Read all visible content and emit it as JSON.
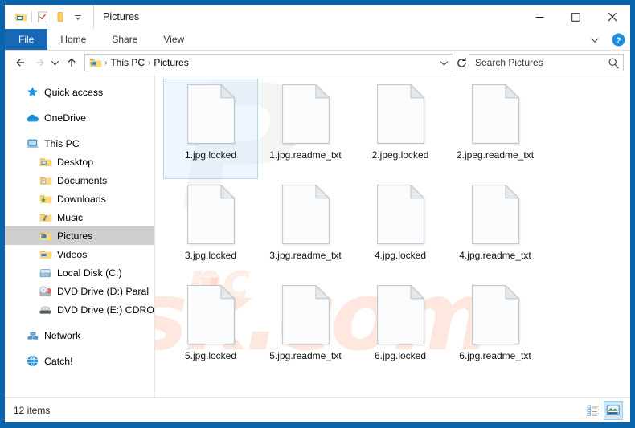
{
  "window": {
    "title": "Pictures",
    "accent_blue": "#0a64ad",
    "file_tab_blue": "#1869b5"
  },
  "quick_access_toolbar": [
    {
      "icon": "explorer-icon",
      "name": "explorer-properties"
    },
    {
      "icon": "properties-checkmark-icon",
      "name": "properties"
    },
    {
      "icon": "new-folder-icon",
      "name": "new-folder"
    },
    {
      "icon": "chevron-down-icon",
      "name": "customize-qat"
    }
  ],
  "window_controls": {
    "minimize": "—",
    "maximize": "☐",
    "close": "✕"
  },
  "ribbon": {
    "file_tab": "File",
    "tabs": [
      "Home",
      "Share",
      "View"
    ],
    "collapse_icon": "chevron-down-icon",
    "help_icon": "help-circle-icon"
  },
  "addressbar": {
    "back_icon": "arrow-left-icon",
    "forward_icon": "arrow-right-icon",
    "recent_icon": "chevron-down-icon",
    "up_icon": "arrow-up-icon",
    "folder_icon": "pictures-folder-icon",
    "crumbs": [
      "This PC",
      "Pictures"
    ],
    "separator": "›",
    "dropdown_icon": "chevron-down-icon",
    "refresh_icon": "refresh-icon"
  },
  "search": {
    "placeholder": "Search Pictures",
    "value": "",
    "icon": "search-icon"
  },
  "sidebar": {
    "items": [
      {
        "label": "Quick access",
        "icon": "star-icon",
        "level": 0,
        "selected": false,
        "gap_after": true
      },
      {
        "label": "OneDrive",
        "icon": "cloud-icon",
        "level": 0,
        "selected": false,
        "gap_after": true
      },
      {
        "label": "This PC",
        "icon": "computer-icon",
        "level": 0,
        "selected": false,
        "gap_after": false
      },
      {
        "label": "Desktop",
        "icon": "desktop-folder-icon",
        "level": 1,
        "selected": false,
        "gap_after": false
      },
      {
        "label": "Documents",
        "icon": "documents-folder-icon",
        "level": 1,
        "selected": false,
        "gap_after": false
      },
      {
        "label": "Downloads",
        "icon": "downloads-folder-icon",
        "level": 1,
        "selected": false,
        "gap_after": false
      },
      {
        "label": "Music",
        "icon": "music-folder-icon",
        "level": 1,
        "selected": false,
        "gap_after": false
      },
      {
        "label": "Pictures",
        "icon": "pictures-folder-icon",
        "level": 1,
        "selected": true,
        "gap_after": false
      },
      {
        "label": "Videos",
        "icon": "videos-folder-icon",
        "level": 1,
        "selected": false,
        "gap_after": false
      },
      {
        "label": "Local Disk (C:)",
        "icon": "hard-drive-icon",
        "level": 1,
        "selected": false,
        "gap_after": false
      },
      {
        "label": "DVD Drive (D:) Paral",
        "icon": "dvd-drive-icon",
        "level": 1,
        "selected": false,
        "gap_after": false
      },
      {
        "label": "DVD Drive (E:) CDRO",
        "icon": "cd-drive-icon",
        "level": 1,
        "selected": false,
        "gap_after": true
      },
      {
        "label": "Network",
        "icon": "network-icon",
        "level": 0,
        "selected": false,
        "gap_after": true
      },
      {
        "label": "Catch!",
        "icon": "catch-globe-icon",
        "level": 0,
        "selected": false,
        "gap_after": false
      }
    ]
  },
  "files": [
    {
      "name": "1.jpg.locked",
      "icon": "blank-document-icon",
      "selected": true
    },
    {
      "name": "1.jpg.readme_txt",
      "icon": "blank-document-icon",
      "selected": false
    },
    {
      "name": "2.jpeg.locked",
      "icon": "blank-document-icon",
      "selected": false
    },
    {
      "name": "2.jpeg.readme_txt",
      "icon": "blank-document-icon",
      "selected": false
    },
    {
      "name": "3.jpg.locked",
      "icon": "blank-document-icon",
      "selected": false
    },
    {
      "name": "3.jpg.readme_txt",
      "icon": "blank-document-icon",
      "selected": false
    },
    {
      "name": "4.jpg.locked",
      "icon": "blank-document-icon",
      "selected": false
    },
    {
      "name": "4.jpg.readme_txt",
      "icon": "blank-document-icon",
      "selected": false
    },
    {
      "name": "5.jpg.locked",
      "icon": "blank-document-icon",
      "selected": false
    },
    {
      "name": "5.jpg.readme_txt",
      "icon": "blank-document-icon",
      "selected": false
    },
    {
      "name": "6.jpg.locked",
      "icon": "blank-document-icon",
      "selected": false
    },
    {
      "name": "6.jpg.readme_txt",
      "icon": "blank-document-icon",
      "selected": false
    }
  ],
  "statusbar": {
    "item_count": "12 items",
    "details_view_icon": "details-view-icon",
    "large_icons_view_icon": "large-icons-view-icon",
    "active_view": "large-icons-view-icon"
  },
  "watermark": {
    "gray_text": "P",
    "orange_text": "risk.com",
    "orange_text_2": "pc"
  }
}
